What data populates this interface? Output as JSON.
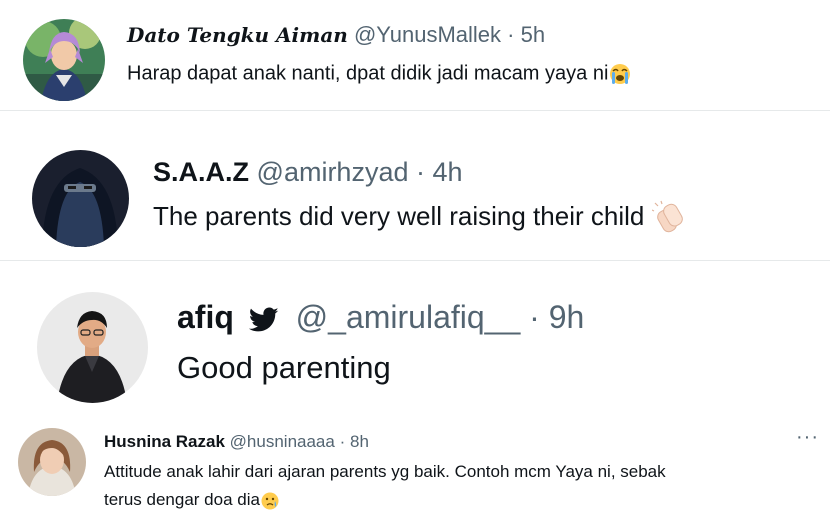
{
  "tweets": [
    {
      "name": "Dato Tengku Aiman",
      "handle": "@YunusMallek",
      "separator": "·",
      "time": "5h",
      "text": "Harap dapat anak nanti, dpat didik jadi macam yaya ni",
      "emoji": "loudly-crying-face"
    },
    {
      "name": "S.A.A.Z",
      "handle": "@amirhzyad",
      "separator": "·",
      "time": "4h",
      "text": "The parents did very well raising their child",
      "emoji": "clapping-hands"
    },
    {
      "name": "afiq",
      "verified_icon": "twitter-bird-icon",
      "handle": "@_amirulafiq__",
      "separator": "·",
      "time": "9h",
      "text": "Good parenting"
    },
    {
      "name": "Husnina Razak",
      "handle": "@husninaaaa",
      "separator": "·",
      "time": "8h",
      "text_line1": "Attitude anak lahir dari ajaran parents yg baik. Contoh mcm Yaya ni, sebak",
      "text_line2": "terus dengar doa dia",
      "emoji": "crying-face",
      "more": "···"
    }
  ],
  "colors": {
    "text": "#0f1419",
    "secondary": "#536471",
    "twitter_blue": "#1d9bf0",
    "divider": "#e6e9ea"
  }
}
